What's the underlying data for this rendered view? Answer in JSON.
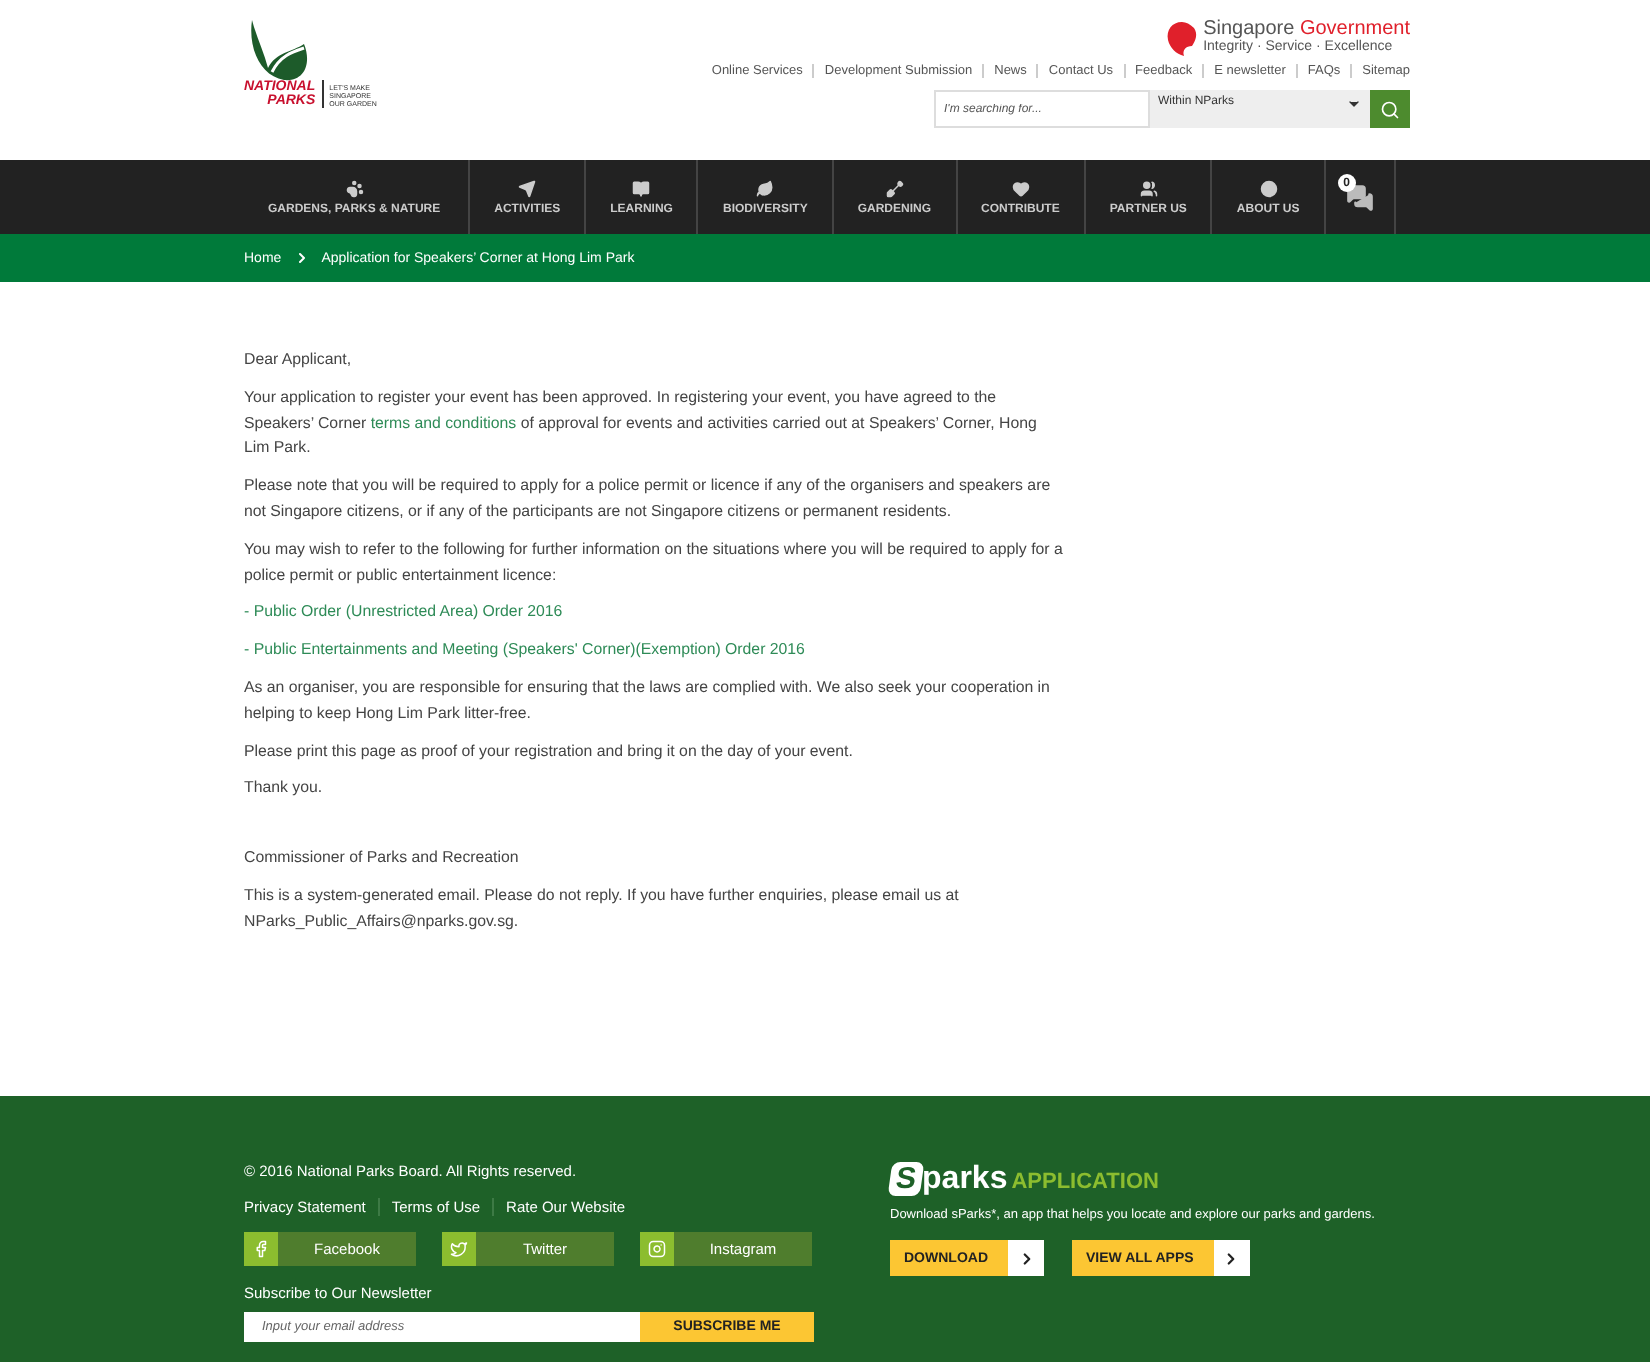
{
  "header": {
    "logo": {
      "name_line1": "NATIONAL",
      "name_line2": "PARKS",
      "slogan": [
        "LET'S MAKE",
        "SINGAPORE",
        "OUR GARDEN"
      ]
    },
    "gov_logo": {
      "word1": "Singapore",
      "word2": "Government",
      "motto": "Integrity · Service · Excellence"
    },
    "top_links": [
      "Online Services",
      "Development Submission",
      "News",
      "Contact Us",
      "Feedback",
      "E newsletter",
      "FAQs",
      "Sitemap"
    ],
    "search": {
      "placeholder": "I'm searching for...",
      "scope": "Within NParks"
    }
  },
  "nav": {
    "items": [
      {
        "label": "GARDENS, PARKS & NATURE"
      },
      {
        "label": "ACTIVITIES"
      },
      {
        "label": "LEARNING"
      },
      {
        "label": "BIODIVERSITY"
      },
      {
        "label": "GARDENING"
      },
      {
        "label": "CONTRIBUTE"
      },
      {
        "label": "PARTNER US"
      },
      {
        "label": "ABOUT US"
      }
    ],
    "chat_count": "0"
  },
  "breadcrumb": [
    "Home",
    "Application for Speakers’ Corner at Hong Lim Park"
  ],
  "content": {
    "paragraphs": [
      [
        {
          "text": "Dear Applicant,"
        }
      ],
      [
        {
          "text": "Your application to register your event has been approved. In registering your event, you have agreed to the Speakers’ Corner "
        },
        {
          "text": "terms and conditions",
          "kind": "link"
        },
        {
          "text": " of approval for events and activities carried out at Speakers’ Corner, Hong Lim Park."
        }
      ],
      [
        {
          "text": "Please note that you will be required to apply for a police permit or licence if any of the organisers and speakers are not Singapore citizens, or if any of the participants are not Singapore citizens or permanent residents."
        }
      ],
      [
        {
          "text": "You may wish to refer to the following for further information on the situations where you will be required to apply for a police permit or public entertainment licence:"
        }
      ],
      [
        {
          "text": "- Public Order (Unrestricted Area) Order 2016",
          "kind": "link"
        }
      ],
      [
        {
          "text": "- Public Entertainments and Meeting (Speakers' Corner)(Exemption) Order 2016",
          "kind": "link"
        }
      ],
      [
        {
          "text": "As an organiser, you are responsible for ensuring that the laws are complied with. We also seek your cooperation in helping to keep Hong Lim Park litter-free."
        }
      ],
      [
        {
          "text": "Please print this page as proof of your registration and bring it on the day of your event."
        }
      ],
      [
        {
          "text": "Thank you."
        }
      ]
    ],
    "signature": "Commissioner of Parks and Recreation",
    "note": "This is a system-generated email. Please do not reply. If you have further enquiries, please email us at NParks_Public_Affairs@nparks.gov.sg."
  },
  "footer": {
    "copyright": "© 2016 National Parks Board. All Rights reserved.",
    "links": [
      "Privacy Statement",
      "Terms of Use",
      "Rate Our Website"
    ],
    "social": [
      {
        "label": "Facebook",
        "kind": "facebook"
      },
      {
        "label": "Twitter",
        "kind": "twitter"
      },
      {
        "label": "Instagram",
        "kind": "instagram"
      }
    ],
    "newsletter_title": "Subscribe to Our Newsletter",
    "email": {
      "placeholder": "Input your email address"
    },
    "subscribe": "SUBSCRIBE ME",
    "app": {
      "initial": "S",
      "rest": "parks",
      "tag": "APPLICATION",
      "description": "Download sParks*, an app that helps you locate and explore our parks and gardens.",
      "buttons": [
        "DOWNLOAD",
        "VIEW ALL APPS"
      ]
    }
  }
}
